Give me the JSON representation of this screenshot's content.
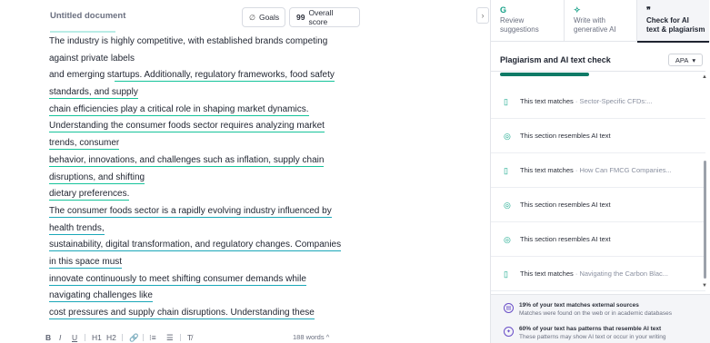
{
  "editor": {
    "title": "Untitled document",
    "goals_label": "Goals",
    "score_num": "99",
    "score_label": "Overall score",
    "lines": [
      {
        "text": "The industry is highly competitive, with established brands competing",
        "style": ""
      },
      {
        "text": "against private labels",
        "style": ""
      },
      {
        "pre": "and emerging st",
        "text": "artups. Additionally, regulatory frameworks, food safety",
        "style": "u"
      },
      {
        "text": "standards, and supply",
        "style": "u"
      },
      {
        "text": "chain efficiencies play a critical role in shaping market dynamics.",
        "style": "u"
      },
      {
        "text": "Understanding the consumer foods sector requires analyzing market",
        "style": "u"
      },
      {
        "text": "trends, consumer",
        "style": "u"
      },
      {
        "text": "behavior, innovations, and challenges such as inflation, supply chain",
        "style": "u"
      },
      {
        "text": "disruptions, and shifting",
        "style": "u"
      },
      {
        "text": "dietary preferences.",
        "style": "u"
      },
      {
        "text": "The consumer foods sector is a rapidly evolving industry influenced by",
        "style": "ud"
      },
      {
        "text": "health trends,",
        "style": "ud"
      },
      {
        "text": "sustainability, digital transformation, and regulatory changes. Companies",
        "style": "ud"
      },
      {
        "text": "in this space must",
        "style": "ud"
      },
      {
        "text": "innovate continuously to meet shifting consumer demands while",
        "style": "ud"
      },
      {
        "text": "navigating challenges like",
        "style": "ud"
      },
      {
        "text": "cost pressures and supply chain disruptions. Understanding these",
        "style": "ud"
      }
    ],
    "toolbar": {
      "bold": "B",
      "italic": "I",
      "underline": "U",
      "h1": "H1",
      "h2": "H2",
      "link": "🔗",
      "ordered_list": "⁝≡",
      "bullet_list": "☰",
      "clear": "T̸",
      "word_count": "188 words",
      "word_count_toggle": "^"
    }
  },
  "panel": {
    "tabs": [
      {
        "line1": "Review",
        "line2": "suggestions",
        "icon": "G",
        "icon_name": "review-icon"
      },
      {
        "line1": "Write with",
        "line2": "generative AI",
        "icon": "✧",
        "icon_name": "sparkle-icon"
      },
      {
        "line1": "Check for AI",
        "line2": "text & plagiarism",
        "icon": "❞",
        "icon_name": "quote-icon"
      }
    ],
    "heading": "Plagiarism and AI text check",
    "citation_style": "APA",
    "citation_caret": "▾",
    "results": [
      {
        "icon": "📄",
        "icon_name": "document-icon",
        "text": "This text matches",
        "source": "· Sector-Specific CFDs:..."
      },
      {
        "icon": "◎",
        "icon_name": "ai-icon",
        "text": "This section resembles AI text",
        "source": ""
      },
      {
        "icon": "📄",
        "icon_name": "document-icon",
        "text": "This text matches",
        "source": "· How Can FMCG Companies..."
      },
      {
        "icon": "◎",
        "icon_name": "ai-icon",
        "text": "This section resembles AI text",
        "source": ""
      },
      {
        "icon": "◎",
        "icon_name": "ai-icon",
        "text": "This section resembles AI text",
        "source": ""
      },
      {
        "icon": "📄",
        "icon_name": "document-icon",
        "text": "This text matches",
        "source": "· Navigating the Carbon Blac..."
      }
    ],
    "summary": [
      {
        "icon": "▢",
        "icon_name": "match-summary-icon",
        "heading": "19% of your text matches external sources",
        "sub": "Matches were found on the web or in academic databases"
      },
      {
        "icon": "◎",
        "icon_name": "ai-summary-icon",
        "heading": "60% of your text has patterns that resemble AI text",
        "sub": "These patterns may show AI text or occur in your writing"
      }
    ],
    "collapse": "›"
  }
}
